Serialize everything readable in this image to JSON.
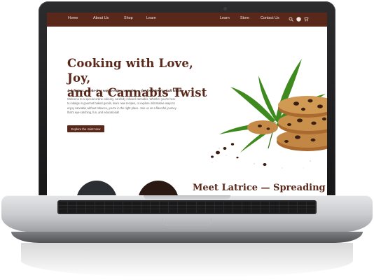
{
  "nav": {
    "left_items": [
      "Home",
      "About Us",
      "Shop",
      "Learn"
    ],
    "right_items": [
      "Learn",
      "Store",
      "Contact Us"
    ],
    "icons": [
      "search-icon",
      "account-icon",
      "cart-icon"
    ]
  },
  "hero": {
    "title_line1": "Cooking with Love, Joy,",
    "title_line2": "and a Cannabis Twist",
    "subtitle": "A delicious, smoke-free way to enjoy cannabis — for food lovers of all kinds.",
    "body": "Welcome to a special online culinary, carefully infused cannabis. Whether you're here to indulge in gourmet baked goods, learn new recipes, or explore informative ways to enjoy cannabis without tobacco, you're in the right place. Join us on a flavorful journey that's eye-catching, fun, and educational!",
    "button_label": "Explore the Joint Now"
  },
  "lower": {
    "heading": "Meet Latrice — Spreading"
  },
  "colors": {
    "brand": "#5a281a",
    "nav_text": "#f2e6dc",
    "leaf": "#3f8a1e",
    "cookie": "#b5773a"
  }
}
